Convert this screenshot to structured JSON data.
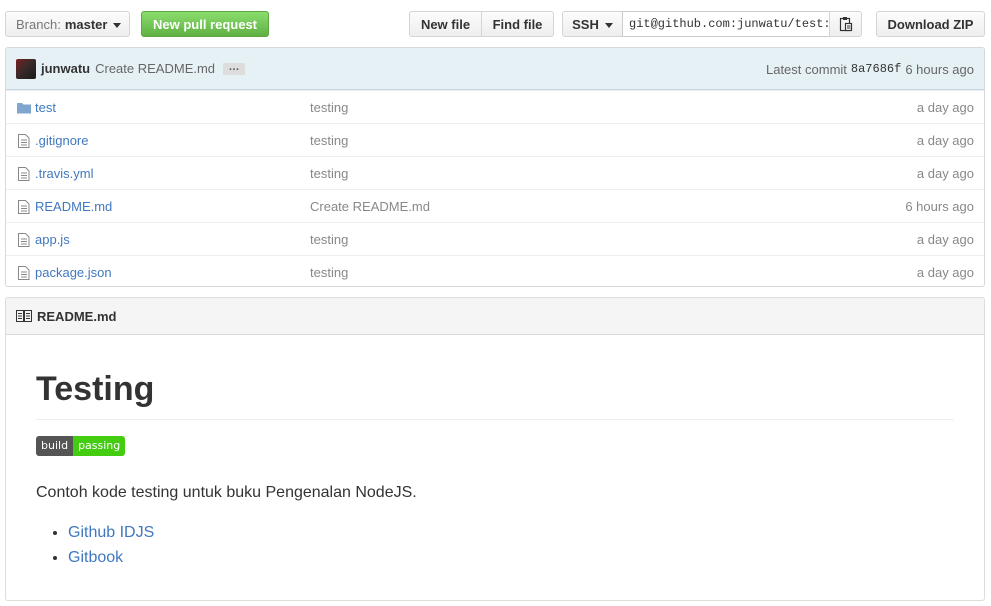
{
  "toolbar": {
    "branch_prefix": "Branch:",
    "branch_name": "master",
    "new_pull_request": "New pull request",
    "new_file": "New file",
    "find_file": "Find file",
    "protocol": "SSH",
    "clone_url": "git@github.com:junwatu/test:",
    "download_zip": "Download ZIP"
  },
  "commit": {
    "author": "junwatu",
    "message": "Create README.md",
    "ellipsis": "…",
    "latest_label": "Latest commit",
    "sha": "8a7686f",
    "age": "6 hours ago"
  },
  "files": [
    {
      "name": "test",
      "type": "folder",
      "message": "testing",
      "age": "a day ago"
    },
    {
      "name": ".gitignore",
      "type": "file",
      "message": "testing",
      "age": "a day ago"
    },
    {
      "name": ".travis.yml",
      "type": "file",
      "message": "testing",
      "age": "a day ago"
    },
    {
      "name": "README.md",
      "type": "file",
      "message": "Create README.md",
      "age": "6 hours ago"
    },
    {
      "name": "app.js",
      "type": "file",
      "message": "testing",
      "age": "a day ago"
    },
    {
      "name": "package.json",
      "type": "file",
      "message": "testing",
      "age": "a day ago"
    }
  ],
  "readme": {
    "header": "README.md",
    "title": "Testing",
    "badge_left": "build",
    "badge_right": "passing",
    "paragraph": "Contoh kode testing untuk buku Pengenalan NodeJS.",
    "links": [
      "Github IDJS",
      "Gitbook"
    ]
  },
  "colors": {
    "link": "#4078c0",
    "primary_button": "#60b044",
    "commit_bar": "#e6f1f6",
    "badge_pass": "#44cc11"
  }
}
